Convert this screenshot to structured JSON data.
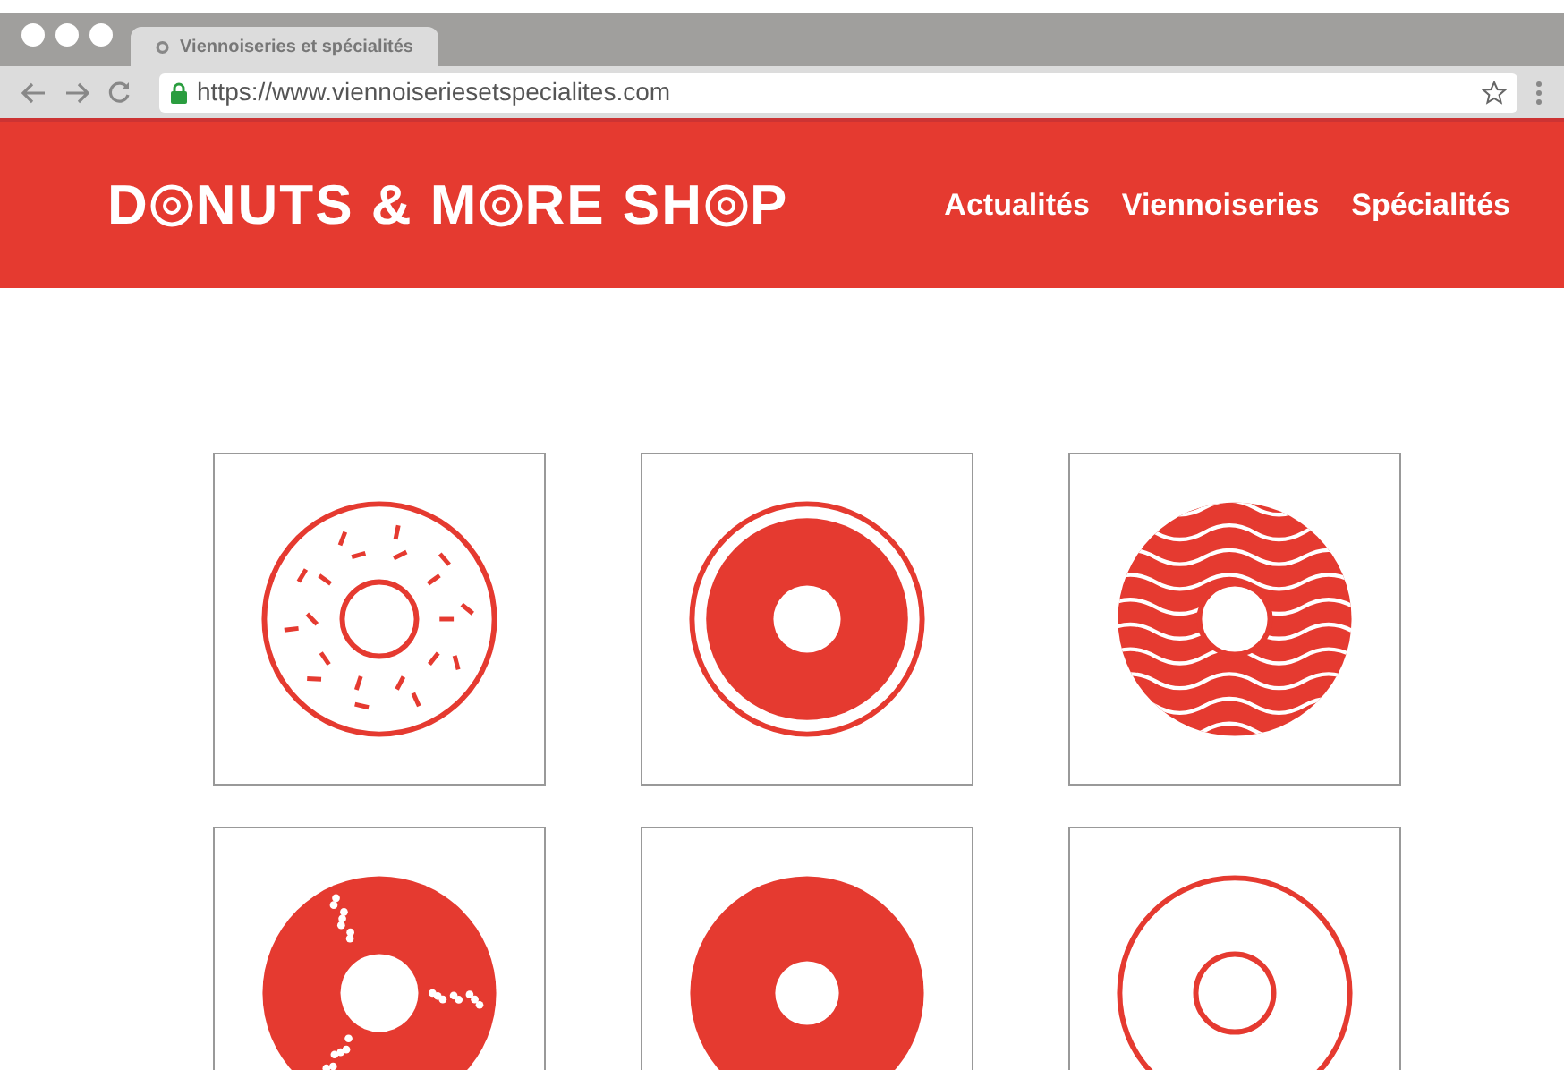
{
  "browser": {
    "tab_title": "Viennoiseries et spécialités",
    "url": "https://www.viennoiseriesetspecialites.com"
  },
  "header": {
    "logo": [
      {
        "kind": "text",
        "text": "D"
      },
      {
        "kind": "donut"
      },
      {
        "kind": "text",
        "text": "NUTS & M"
      },
      {
        "kind": "donut"
      },
      {
        "kind": "text",
        "text": "RE SH"
      },
      {
        "kind": "donut"
      },
      {
        "kind": "text",
        "text": "P"
      }
    ],
    "nav": [
      "Actualités",
      "Viennoiseries",
      "Spécialités"
    ]
  },
  "tiles": [
    {
      "kind": "sprinkles"
    },
    {
      "kind": "ring"
    },
    {
      "kind": "waves"
    },
    {
      "kind": "dots"
    },
    {
      "kind": "solid"
    },
    {
      "kind": "outline"
    }
  ]
}
